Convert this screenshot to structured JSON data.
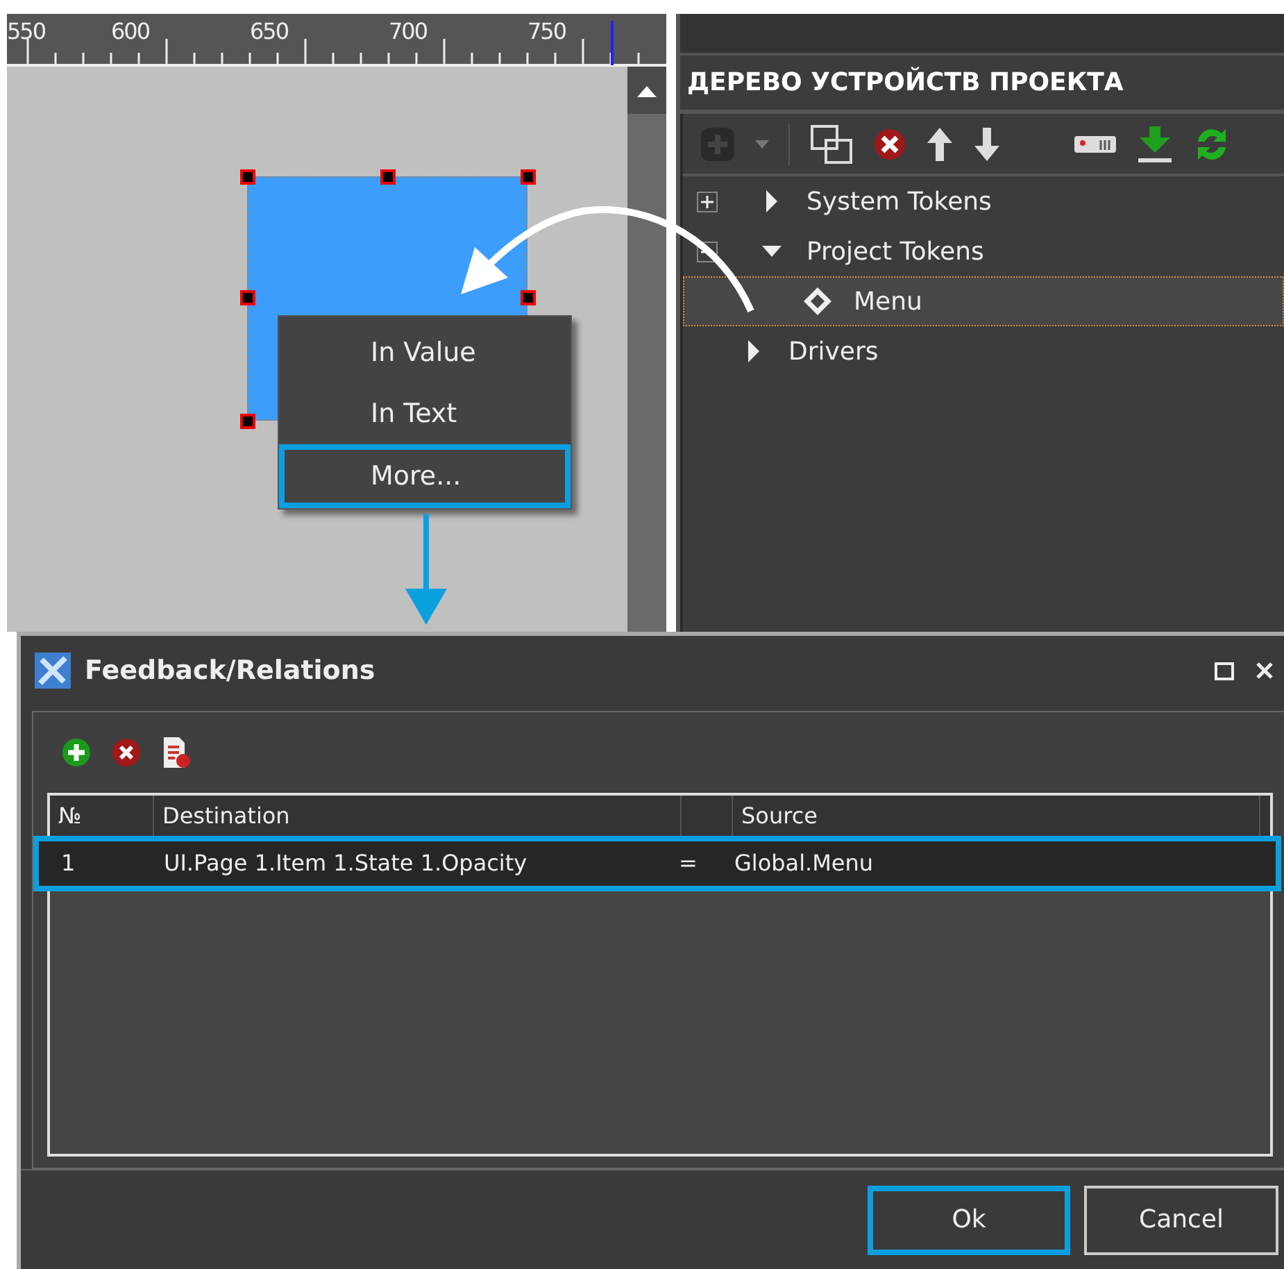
{
  "canvas": {
    "ruler_labels": [
      "550",
      "600",
      "650",
      "700",
      "750"
    ]
  },
  "context_menu": {
    "items": [
      {
        "label": "In Value",
        "highlighted": false
      },
      {
        "label": "In Text",
        "highlighted": false
      },
      {
        "label": "More...",
        "highlighted": true
      }
    ]
  },
  "device_tree": {
    "title": "ДЕРЕВО УСТРОЙСТВ ПРОЕКТА",
    "add_disabled": true,
    "items": [
      {
        "label": "System Tokens",
        "kind": "branch",
        "expanded": false,
        "selected": false
      },
      {
        "label": "Project Tokens",
        "kind": "branch",
        "expanded": true,
        "selected": false,
        "children": [
          {
            "label": "Menu",
            "kind": "token",
            "selected": true
          }
        ]
      },
      {
        "label": "Drivers",
        "kind": "plain",
        "expanded": false,
        "selected": false
      }
    ]
  },
  "dialog": {
    "title": "Feedback/Relations",
    "table": {
      "columns": [
        {
          "label": "№"
        },
        {
          "label": "Destination"
        },
        {
          "label": "Source"
        }
      ],
      "rows": [
        {
          "number": "1",
          "destination": "UI.Page 1.Item 1.State 1.Opacity",
          "operator": "=",
          "source": "Global.Menu",
          "selected": true
        }
      ]
    },
    "buttons": [
      {
        "label": "Ok",
        "focused": true
      },
      {
        "label": "Cancel",
        "focused": false
      }
    ]
  }
}
